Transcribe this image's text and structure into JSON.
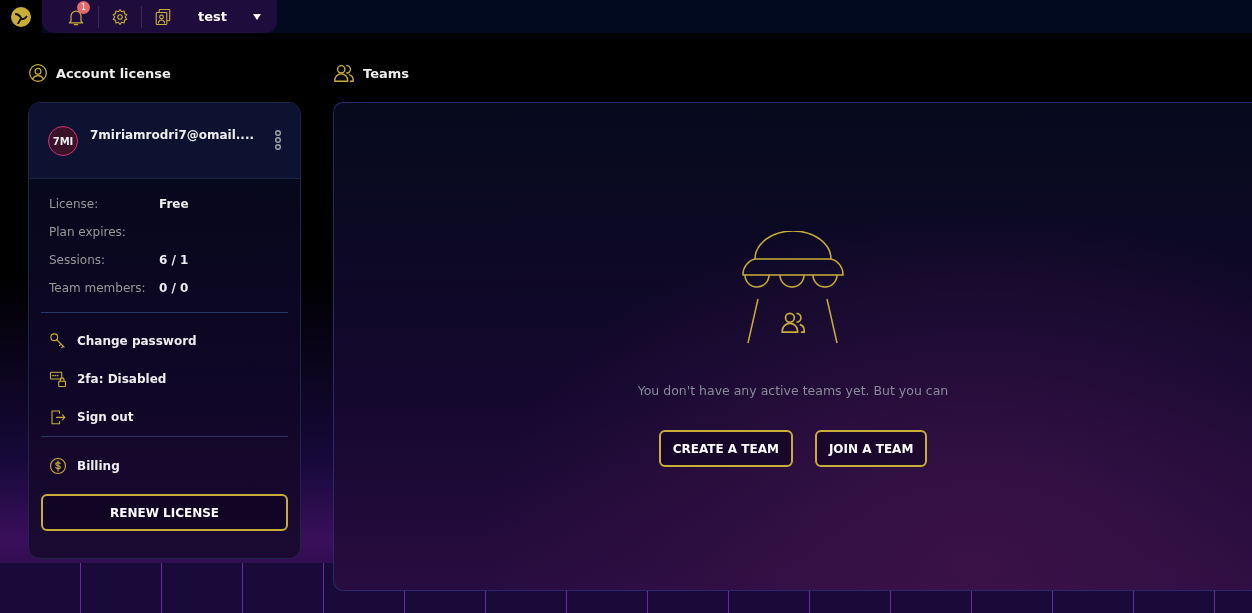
{
  "topbar": {
    "notification_count": "1",
    "profile_name": "test"
  },
  "account": {
    "title": "Account license",
    "avatar": "7MI",
    "email": "7miriamrodri7@omail....",
    "details": [
      {
        "label": "License:",
        "value": "Free"
      },
      {
        "label": "Plan expires:"
      },
      {
        "label": "Sessions:",
        "value": "6 / 1"
      },
      {
        "label": "Team members:",
        "value": "0 / 0"
      }
    ],
    "actions": [
      {
        "kind": "key",
        "label": "Change password"
      },
      {
        "kind": "lock",
        "label": "2fa: Disabled"
      },
      {
        "kind": "exit",
        "label": "Sign out"
      }
    ],
    "billing": "Billing",
    "renew_button": "RENEW LICENSE"
  },
  "teams": {
    "title": "Teams",
    "message": "You don't have any active teams yet. But you can",
    "buttons": [
      "CREATE A TEAM",
      "JOIN A TEAM"
    ]
  }
}
